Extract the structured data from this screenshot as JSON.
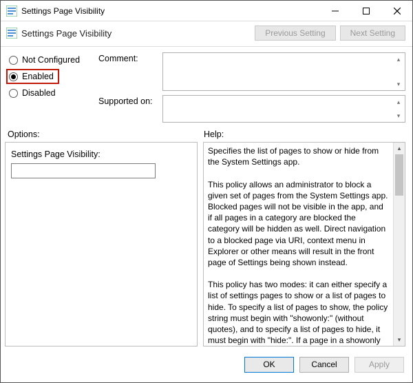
{
  "window": {
    "title": "Settings Page Visibility"
  },
  "header": {
    "title": "Settings Page Visibility",
    "prev_label": "Previous Setting",
    "next_label": "Next Setting"
  },
  "radios": {
    "not_configured": "Not Configured",
    "enabled": "Enabled",
    "disabled": "Disabled"
  },
  "comment": {
    "label": "Comment:"
  },
  "supported": {
    "label": "Supported on:"
  },
  "options": {
    "section_label": "Options:",
    "field_label": "Settings Page Visibility:",
    "field_value": ""
  },
  "help": {
    "section_label": "Help:",
    "text": "Specifies the list of pages to show or hide from the System Settings app.\n\nThis policy allows an administrator to block a given set of pages from the System Settings app. Blocked pages will not be visible in the app, and if all pages in a category are blocked the category will be hidden as well. Direct navigation to a blocked page via URI, context menu in Explorer or other means will result in the front page of Settings being shown instead.\n\nThis policy has two modes: it can either specify a list of settings pages to show or a list of pages to hide. To specify a list of pages to show, the policy string must begin with \"showonly:\" (without quotes), and to specify a list of pages to hide, it must begin with \"hide:\". If a page in a showonly list would normally be hidden for other reasons (such as a missing hardware device), this policy will not force that page to appear. After this, the policy string must contain a semicolon-delimited list of settings page identifiers. The identifier for any given settings page is the published URI for that page, minus the \"ms-settings:\" protocol part."
  },
  "footer": {
    "ok": "OK",
    "cancel": "Cancel",
    "apply": "Apply"
  }
}
